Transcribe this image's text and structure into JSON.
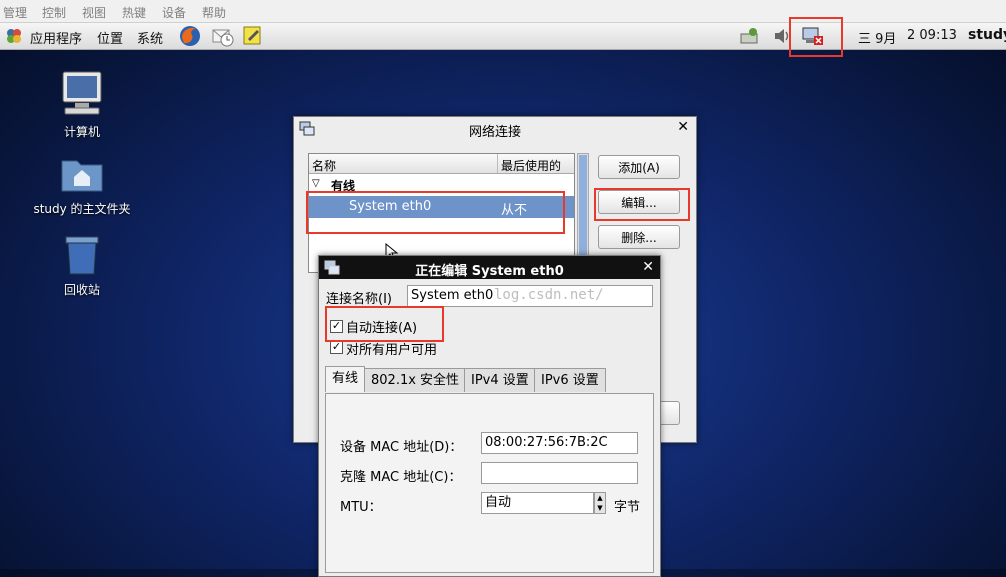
{
  "vm_menu": [
    "管理",
    "控制",
    "视图",
    "热键",
    "设备",
    "帮助"
  ],
  "panel": {
    "menus": [
      "应用程序",
      "位置",
      "系统"
    ],
    "date": "三 9月",
    "time": "2 09:13",
    "user": "study"
  },
  "desktop_icons": [
    {
      "label": "计算机"
    },
    {
      "label": "study 的主文件夹"
    },
    {
      "label": "回收站"
    }
  ],
  "net_window": {
    "title": "网络连接",
    "col_name": "名称",
    "col_last": "最后使用的",
    "group": "有线",
    "row_name": "System eth0",
    "row_last": "从不",
    "btn_add": "添加(A)",
    "btn_edit": "编辑...",
    "btn_delete": "删除..."
  },
  "edit_dialog": {
    "title": "正在编辑 System eth0",
    "conn_name_label": "连接名称(I)",
    "conn_name_value": "System eth0",
    "auto_connect_label": "自动连接(A)",
    "all_users_label": "对所有用户可用",
    "tabs": [
      "有线",
      "802.1x 安全性",
      "IPv4 设置",
      "IPv6 设置"
    ],
    "mac_label": "设备 MAC 地址(D)：",
    "mac_value": "08:00:27:56:7B:2C",
    "clone_label": "克隆 MAC 地址(C)：",
    "clone_value": "",
    "mtu_label": "MTU：",
    "mtu_value": "自动",
    "mtu_unit": "字节"
  },
  "watermark": "log.csdn.net/"
}
